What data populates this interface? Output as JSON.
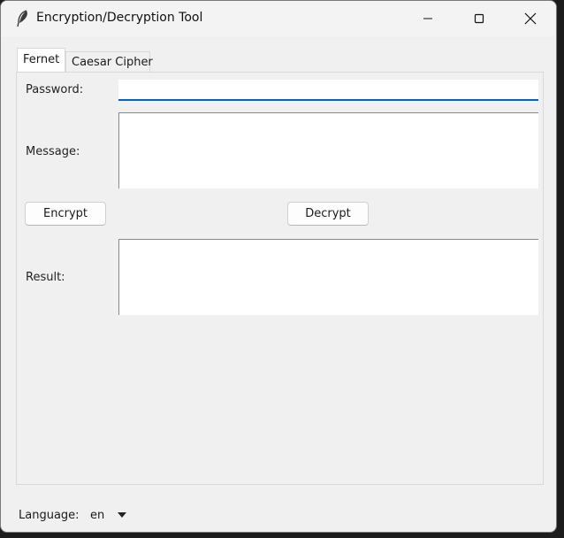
{
  "window": {
    "title": "Encryption/Decryption Tool",
    "icon": "feather-icon"
  },
  "tabs": [
    {
      "label": "Fernet",
      "active": true
    },
    {
      "label": "Caesar Cipher",
      "active": false
    }
  ],
  "form": {
    "password_label": "Password:",
    "password_value": "",
    "message_label": "Message:",
    "message_value": "",
    "result_label": "Result:",
    "result_value": "",
    "encrypt_label": "Encrypt",
    "decrypt_label": "Decrypt"
  },
  "footer": {
    "language_label": "Language:",
    "language_value": "en"
  },
  "colors": {
    "focus_accent": "#0067c0"
  }
}
